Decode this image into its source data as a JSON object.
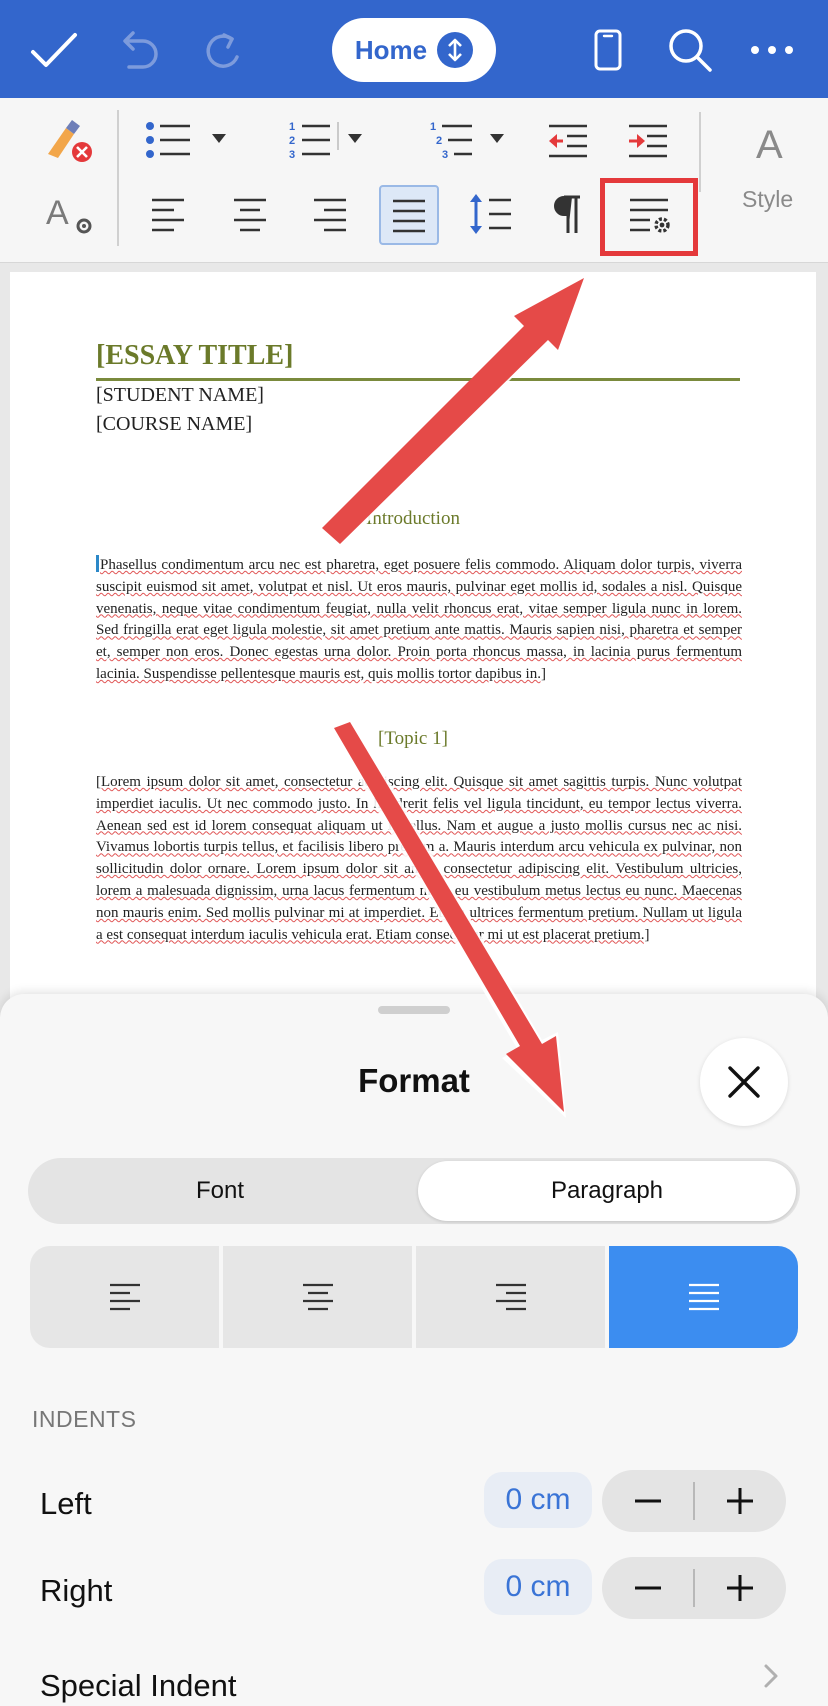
{
  "toolbar": {
    "home_label": "Home",
    "style_label": "Style"
  },
  "document": {
    "essay_title": "[ESSAY TITLE]",
    "student_name": "[STUDENT NAME]",
    "course_name": "[COURSE NAME]",
    "heading_intro": "Introduction",
    "para_intro": "Phasellus condimentum arcu nec est pharetra, eget posuere felis commodo. Aliquam dolor turpis, viverra suscipit euismod sit amet, volutpat et nisl. Ut eros mauris, pulvinar eget mollis id, sodales a nisl. Quisque venenatis, neque vitae condimentum feugiat, nulla velit rhoncus erat, vitae semper ligula nunc in lorem. Sed fringilla erat eget ligula molestie, sit amet pretium ante mattis. Mauris sapien nisi, pharetra et semper et, semper non eros. Donec egestas urna dolor. Proin porta rhoncus massa, in lacinia purus fermentum lacinia. Suspendisse pellentesque mauris est, quis mollis tortor dapibus in.]",
    "heading_topic": "[Topic 1]",
    "para_topic": "[Lorem ipsum dolor sit amet, consectetur adipiscing elit. Quisque sit amet sagittis turpis. Nunc volutpat imperdiet iaculis. Ut nec commodo justo. In hendrerit felis vel ligula tincidunt, eu tempor lectus viverra. Aenean sed est id lorem consequat aliquam ut in tellus. Nam et augue a justo mollis cursus nec ac nisi. Vivamus lobortis turpis tellus, et facilisis libero pretium a. Mauris interdum arcu vehicula ex pulvinar, non sollicitudin dolor ornare. Lorem ipsum dolor sit amet, consectetur adipiscing elit. Vestibulum ultricies, lorem a malesuada dignissim, urna lacus fermentum nibh, eu vestibulum metus lectus eu nunc. Maecenas non mauris enim. Sed mollis pulvinar mi at imperdiet. Etiam ultrices fermentum pretium. Nullam ut ligula a est consequat interdum iaculis vehicula erat. Etiam consectetur mi ut est placerat pretium.]"
  },
  "format_panel": {
    "title": "Format",
    "tabs": [
      {
        "label": "Font",
        "selected": false
      },
      {
        "label": "Paragraph",
        "selected": true
      }
    ],
    "alignment_selected": "justify",
    "indents_section": "INDENTS",
    "left_label": "Left",
    "left_value": "0 cm",
    "right_label": "Right",
    "right_value": "0 cm",
    "special_indent_label": "Special Indent"
  },
  "colors": {
    "toolbar_blue": "#3366cc",
    "accent_blue": "#3c8df0",
    "highlight_red": "#e4393b",
    "title_olive": "#6b7a2a"
  }
}
